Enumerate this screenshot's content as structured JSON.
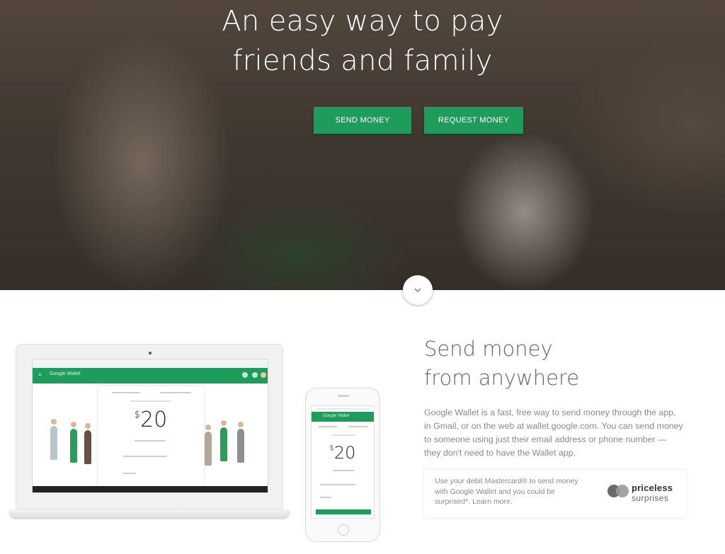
{
  "hero": {
    "title_line1": "An easy way to pay",
    "title_line2": "friends and family",
    "send_button": "SEND MONEY",
    "request_button": "REQUEST MONEY"
  },
  "section": {
    "title_line1": "Send money",
    "title_line2": "from anywhere",
    "description": "Google Wallet is a fast, free way to send money through the app, in Gmail, or on the web at wallet.google.com. You can send money to someone using just their email address or phone number — they don't need to have the Wallet app."
  },
  "device_mockups": {
    "laptop_app_name": "Google Wallet",
    "laptop_amount_symbol": "$",
    "laptop_amount_value": "20",
    "phone_app_name": "Google Wallet",
    "phone_amount_symbol": "$",
    "phone_amount_value": "20"
  },
  "promo": {
    "text": "Use your debit Mastercard® to send money with Google Wallet and you could be surprised*.",
    "link": "Learn more.",
    "brand_line1": "priceless",
    "brand_line2": "surprises"
  },
  "colors": {
    "accent_green": "#1e9c5b",
    "heading_gray": "#666666",
    "body_gray": "#8a8a8a"
  },
  "icons": {
    "scroll_down": "chevron-down-icon",
    "mastercard": "mastercard-logo-icon"
  }
}
